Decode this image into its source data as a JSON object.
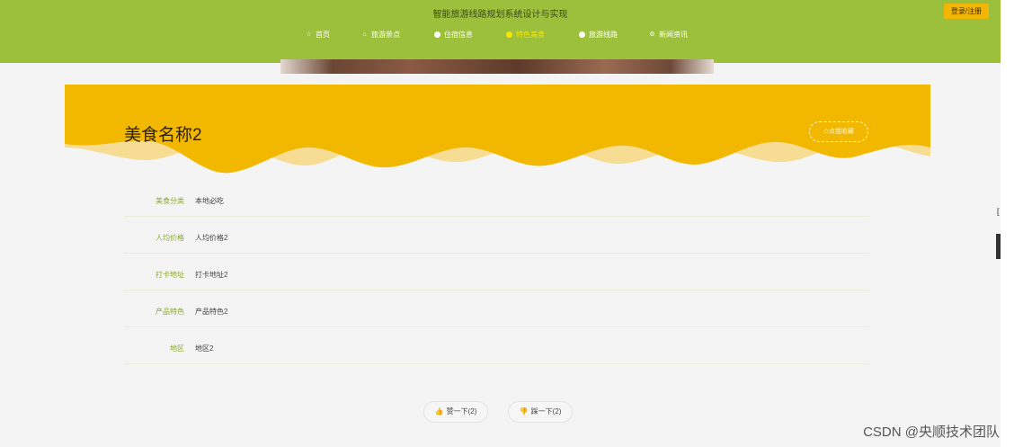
{
  "header": {
    "site_title": "智能旅游线路规划系统设计与实现",
    "login_label": "登录/注册",
    "colors": {
      "header_bg": "#9cc03c",
      "accent": "#f2b705",
      "active_nav": "#f7e600"
    },
    "nav": [
      {
        "label": "首页",
        "icon": "star-icon",
        "active": false
      },
      {
        "label": "旅游景点",
        "icon": "home-icon",
        "active": false
      },
      {
        "label": "住宿信息",
        "icon": "dot-icon",
        "active": false
      },
      {
        "label": "特色美食",
        "icon": "dot-icon",
        "active": true
      },
      {
        "label": "旅游线路",
        "icon": "dot-icon",
        "active": false
      },
      {
        "label": "新闻资讯",
        "icon": "gear-icon",
        "active": false
      }
    ]
  },
  "food": {
    "name": "美食名称2",
    "favorite_label": "✩点我收藏",
    "card_color": "#f2b800"
  },
  "details": [
    {
      "label": "美食分类",
      "value": "本地必吃"
    },
    {
      "label": "人均价格",
      "value": "人均价格2"
    },
    {
      "label": "打卡地址",
      "value": "打卡地址2"
    },
    {
      "label": "产品特色",
      "value": "产品特色2"
    },
    {
      "label": "地区",
      "value": "地区2"
    }
  ],
  "votes": {
    "like_label": "赞一下(2)",
    "dislike_label": "踩一下(2)"
  },
  "watermark": "CSDN @央顺技术团队"
}
